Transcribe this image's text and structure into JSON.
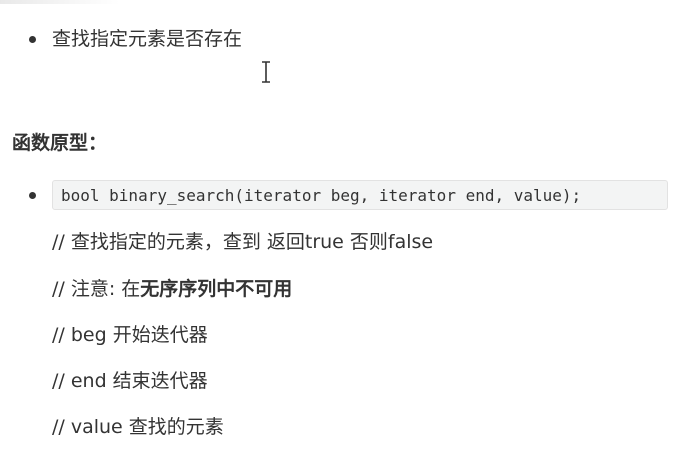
{
  "list1": {
    "item": "查找指定元素是否存在"
  },
  "section": {
    "heading": "函数原型："
  },
  "list2": {
    "code": "bool binary_search(iterator beg, iterator end, value);"
  },
  "comments": {
    "line1": "// 查找指定的元素，查到 返回true  否则false",
    "line2_prefix": "// 注意: 在",
    "line2_bold": "无序序列中不可用",
    "line3": "// beg 开始迭代器",
    "line4": "// end 结束迭代器",
    "line5": "// value 查找的元素"
  },
  "icons": {
    "cursor": "text-cursor-icon"
  }
}
